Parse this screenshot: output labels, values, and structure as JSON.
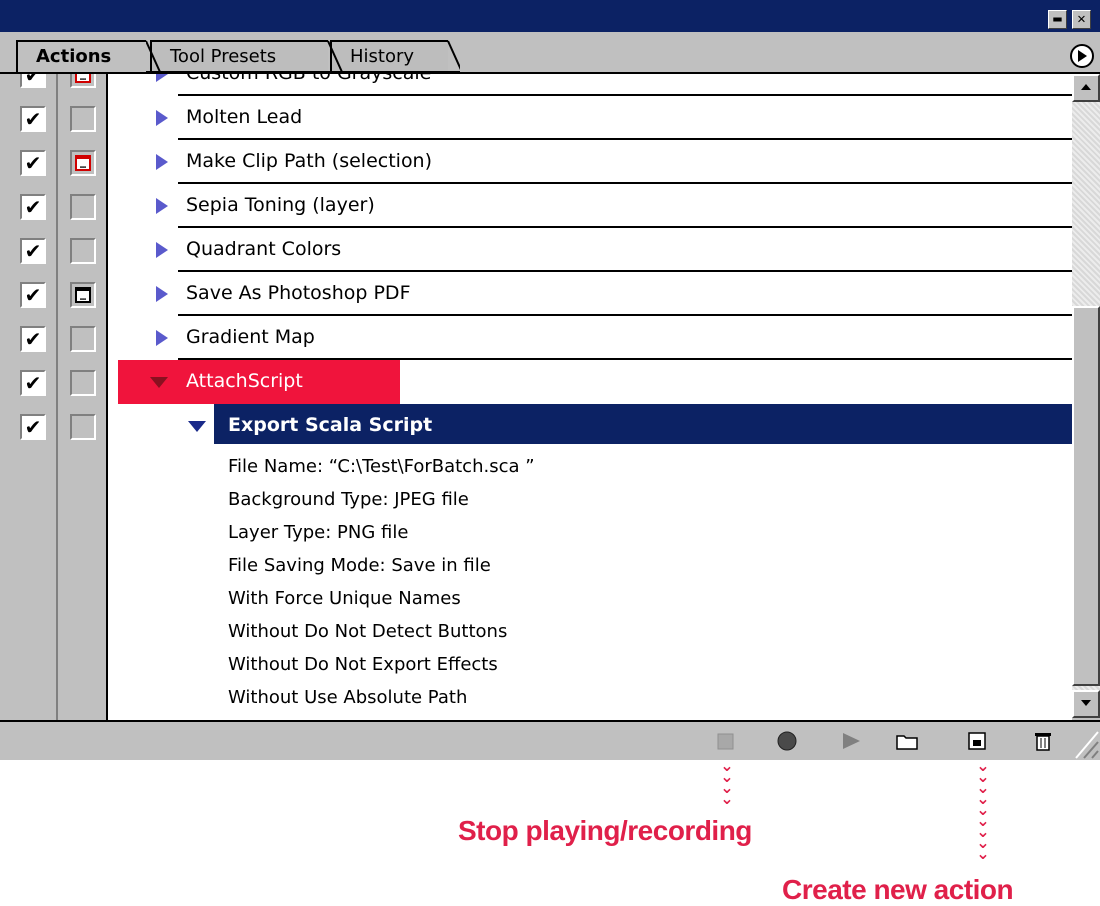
{
  "tabs": [
    {
      "label": "Actions"
    },
    {
      "label": "Tool Presets"
    },
    {
      "label": "History"
    }
  ],
  "window_controls": {
    "minimize": "▬",
    "close": "✕"
  },
  "rows": [
    {
      "label": "Custom RGB to Grayscale",
      "checked": true,
      "dialog": "red",
      "expanded": false
    },
    {
      "label": "Molten Lead",
      "checked": true,
      "dialog": "none",
      "expanded": false
    },
    {
      "label": "Make Clip Path (selection)",
      "checked": true,
      "dialog": "red",
      "expanded": false
    },
    {
      "label": "Sepia Toning (layer)",
      "checked": true,
      "dialog": "none",
      "expanded": false
    },
    {
      "label": "Quadrant Colors",
      "checked": true,
      "dialog": "none",
      "expanded": false
    },
    {
      "label": "Save As Photoshop PDF",
      "checked": true,
      "dialog": "black",
      "expanded": false
    },
    {
      "label": "Gradient Map",
      "checked": true,
      "dialog": "none",
      "expanded": false
    },
    {
      "label": "AttachScript",
      "checked": true,
      "dialog": "none",
      "expanded": true,
      "highlight": "#f0143c"
    },
    {
      "label": "Export Scala Script",
      "checked": true,
      "dialog": "none",
      "expanded": true,
      "selected": true
    }
  ],
  "details": [
    "File Name:  “C:\\Test\\ForBatch.sca ”",
    "Background Type: JPEG file",
    "Layer Type: PNG file",
    "File Saving Mode: Save in file",
    "With Force Unique Names",
    "Without Do Not Detect Buttons",
    "Without Do Not Export Effects",
    "Without Use Absolute Path"
  ],
  "toolbar_icons": [
    "stop-icon",
    "record-icon",
    "play-icon",
    "folder-icon",
    "new-action-icon",
    "trash-icon"
  ],
  "annotations": {
    "stop": "Stop playing/recording",
    "create": "Create new action"
  },
  "colors": {
    "titlebar": "#0c2264",
    "selected_row": "#0c2264",
    "highlight": "#f0143c",
    "annotation": "#e0204a",
    "triangle": "#5a5acc"
  }
}
